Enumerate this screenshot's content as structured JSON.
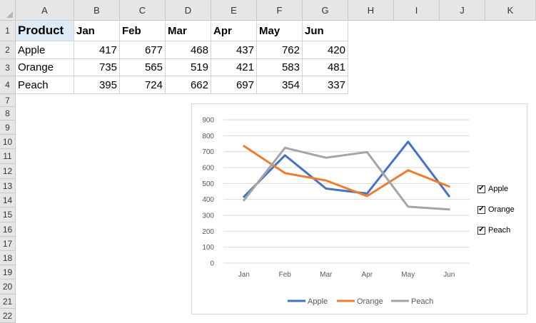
{
  "columns": [
    "A",
    "B",
    "C",
    "D",
    "E",
    "F",
    "G",
    "H",
    "I",
    "J",
    "K"
  ],
  "rows": [
    "1",
    "2",
    "3",
    "4",
    "7",
    "8",
    "9",
    "10",
    "11",
    "12",
    "13",
    "14",
    "15",
    "16",
    "17",
    "18",
    "19",
    "20",
    "21",
    "22"
  ],
  "table": {
    "header": [
      "Product",
      "Jan",
      "Feb",
      "Mar",
      "Apr",
      "May",
      "Jun"
    ],
    "rows": [
      {
        "label": "Apple",
        "values": [
          "417",
          "677",
          "468",
          "437",
          "762",
          "420"
        ]
      },
      {
        "label": "Orange",
        "values": [
          "735",
          "565",
          "519",
          "421",
          "583",
          "481"
        ]
      },
      {
        "label": "Peach",
        "values": [
          "395",
          "724",
          "662",
          "697",
          "354",
          "337"
        ]
      }
    ]
  },
  "chart_data": {
    "type": "line",
    "categories": [
      "Jan",
      "Feb",
      "Mar",
      "Apr",
      "May",
      "Jun"
    ],
    "series": [
      {
        "name": "Apple",
        "values": [
          417,
          677,
          468,
          437,
          762,
          420
        ],
        "color": "#4472c4"
      },
      {
        "name": "Orange",
        "values": [
          735,
          565,
          519,
          421,
          583,
          481
        ],
        "color": "#ed7d31"
      },
      {
        "name": "Peach",
        "values": [
          395,
          724,
          662,
          697,
          354,
          337
        ],
        "color": "#a5a5a5"
      }
    ],
    "yticks": [
      "0",
      "100",
      "200",
      "300",
      "400",
      "500",
      "600",
      "700",
      "800",
      "900"
    ],
    "ylim": [
      0,
      900
    ],
    "grid": true,
    "legend": "bottom",
    "title": ""
  },
  "checkboxes": [
    {
      "label": "Apple",
      "checked": true
    },
    {
      "label": "Orange",
      "checked": true
    },
    {
      "label": "Peach",
      "checked": true
    }
  ]
}
